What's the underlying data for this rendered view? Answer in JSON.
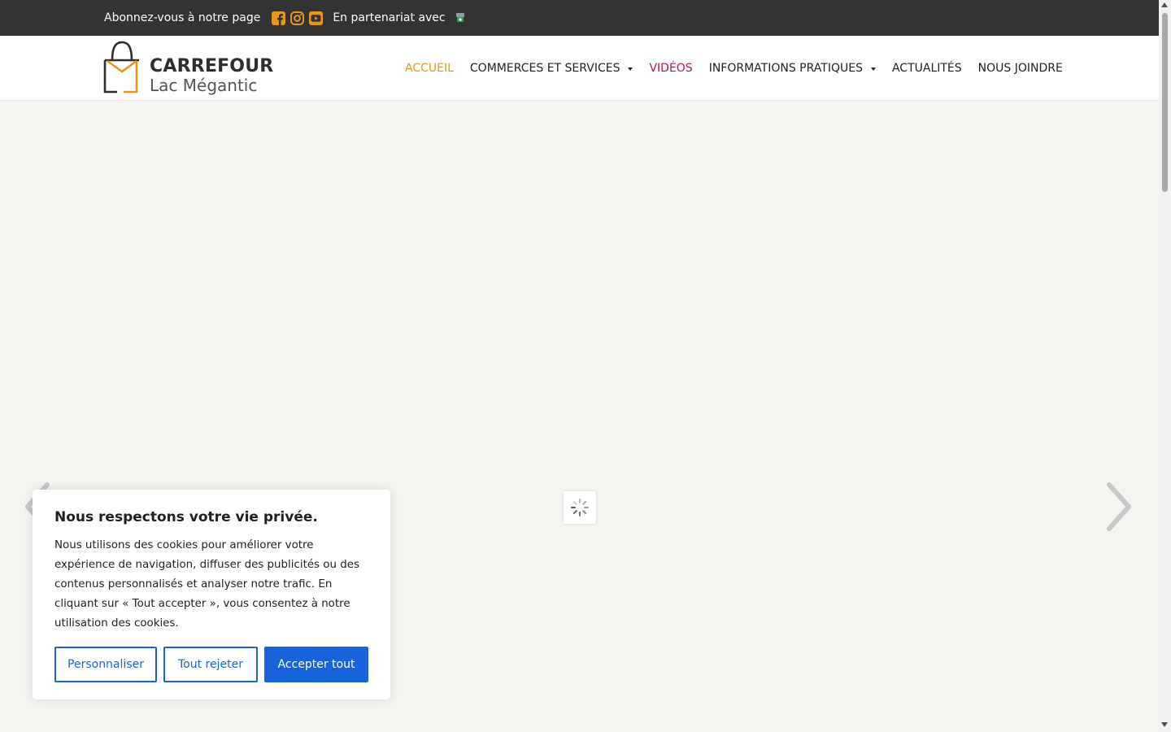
{
  "topbar": {
    "subscribe_text": "Abonnez-vous à notre page",
    "social_icons": [
      "facebook-icon",
      "instagram-icon",
      "youtube-icon"
    ],
    "partner_text": "En partenariat avec",
    "social_color": "#e8961e"
  },
  "header": {
    "logo_line1": "CARREFOUR",
    "logo_line2": "Lac Mégantic"
  },
  "nav": {
    "items": [
      {
        "label": "ACCUEIL",
        "state": "active"
      },
      {
        "label": "COMMERCES ET SERVICES",
        "dropdown": true
      },
      {
        "label": "VIDÉOS"
      },
      {
        "label": "INFORMATIONS PRATIQUES",
        "dropdown": true
      },
      {
        "label": "ACTUALITÉS"
      },
      {
        "label": "NOUS JOINDRE"
      }
    ],
    "active_color": "#e8961e",
    "videos_color": "#b5174d"
  },
  "cookie": {
    "title": "Nous respectons votre vie privée.",
    "body": "Nous utilisons des cookies pour améliorer votre expérience de navigation, diffuser des publicités ou des contenus personnalisés et analyser notre trafic. En cliquant sur « Tout accepter », vous consentez à notre utilisation des cookies.",
    "customize_label": "Personnaliser",
    "reject_label": "Tout rejeter",
    "accept_label": "Accepter tout",
    "accent_color": "#1863dc"
  }
}
